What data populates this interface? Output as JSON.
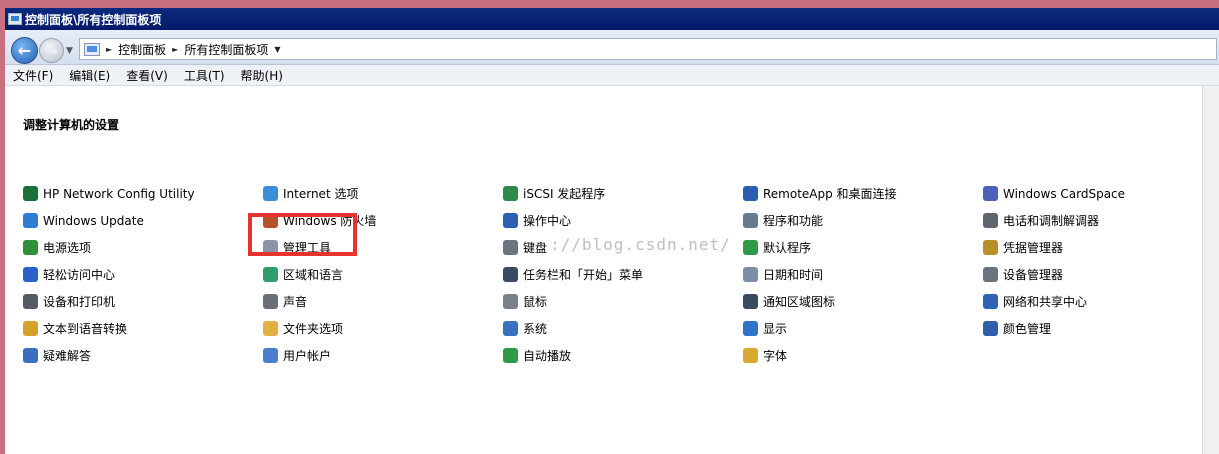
{
  "window": {
    "title": "控制面板\\所有控制面板项"
  },
  "address": {
    "crumbs": [
      "控制面板",
      "所有控制面板项"
    ]
  },
  "menu": [
    "文件(F)",
    "编辑(E)",
    "查看(V)",
    "工具(T)",
    "帮助(H)"
  ],
  "heading": "调整计算机的设置",
  "watermark": "://blog.csdn.net/",
  "columns": [
    [
      {
        "label": "HP Network Config Utility",
        "icon": "network-utility-icon",
        "color": "#1d6f3a"
      },
      {
        "label": "Windows Update",
        "icon": "windows-update-icon",
        "color": "#2e7bd6"
      },
      {
        "label": "电源选项",
        "icon": "power-options-icon",
        "color": "#2f8f3a"
      },
      {
        "label": "轻松访问中心",
        "icon": "ease-of-access-icon",
        "color": "#2a62c9"
      },
      {
        "label": "设备和打印机",
        "icon": "printer-icon",
        "color": "#555a66"
      },
      {
        "label": "文本到语音转换",
        "icon": "speech-icon",
        "color": "#d4a22a"
      },
      {
        "label": "疑难解答",
        "icon": "troubleshooting-icon",
        "color": "#3a6fbf"
      }
    ],
    [
      {
        "label": "Internet 选项",
        "icon": "internet-options-icon",
        "color": "#3a8fd8"
      },
      {
        "label": "Windows 防火墙",
        "icon": "firewall-icon",
        "color": "#b5502a"
      },
      {
        "label": "管理工具",
        "icon": "admin-tools-icon",
        "color": "#8a95a6"
      },
      {
        "label": "区域和语言",
        "icon": "region-language-icon",
        "color": "#2f9e6a"
      },
      {
        "label": "声音",
        "icon": "sound-icon",
        "color": "#6a6f78"
      },
      {
        "label": "文件夹选项",
        "icon": "folder-options-icon",
        "color": "#e0b040"
      },
      {
        "label": "用户帐户",
        "icon": "user-accounts-icon",
        "color": "#4a7fcf"
      }
    ],
    [
      {
        "label": "iSCSI 发起程序",
        "icon": "iscsi-icon",
        "color": "#2c8a4a"
      },
      {
        "label": "操作中心",
        "icon": "action-center-icon",
        "color": "#2b5fb5"
      },
      {
        "label": "键盘",
        "icon": "keyboard-icon",
        "color": "#6d7480"
      },
      {
        "label": "任务栏和「开始」菜单",
        "icon": "taskbar-icon",
        "color": "#3b4a63"
      },
      {
        "label": "鼠标",
        "icon": "mouse-icon",
        "color": "#7a8089"
      },
      {
        "label": "系统",
        "icon": "system-icon",
        "color": "#3a70c0"
      },
      {
        "label": "自动播放",
        "icon": "autoplay-icon",
        "color": "#2f9a48"
      }
    ],
    [
      {
        "label": "RemoteApp 和桌面连接",
        "icon": "remoteapp-icon",
        "color": "#2a5db0"
      },
      {
        "label": "程序和功能",
        "icon": "programs-features-icon",
        "color": "#6a7a90"
      },
      {
        "label": "默认程序",
        "icon": "default-programs-icon",
        "color": "#2f9a4a"
      },
      {
        "label": "日期和时间",
        "icon": "date-time-icon",
        "color": "#7c8ea8"
      },
      {
        "label": "通知区域图标",
        "icon": "notification-area-icon",
        "color": "#3a4a60"
      },
      {
        "label": "显示",
        "icon": "display-icon",
        "color": "#2f74c8"
      },
      {
        "label": "字体",
        "icon": "fonts-icon",
        "color": "#d9a830"
      }
    ],
    [
      {
        "label": "Windows CardSpace",
        "icon": "cardspace-icon",
        "color": "#4b62b8"
      },
      {
        "label": "电话和调制解调器",
        "icon": "phone-modem-icon",
        "color": "#5f6670"
      },
      {
        "label": "凭据管理器",
        "icon": "credential-manager-icon",
        "color": "#b8902a"
      },
      {
        "label": "设备管理器",
        "icon": "device-manager-icon",
        "color": "#6a7380"
      },
      {
        "label": "网络和共享中心",
        "icon": "network-sharing-icon",
        "color": "#2f63b8"
      },
      {
        "label": "颜色管理",
        "icon": "color-management-icon",
        "color": "#2e5ea8"
      }
    ]
  ]
}
